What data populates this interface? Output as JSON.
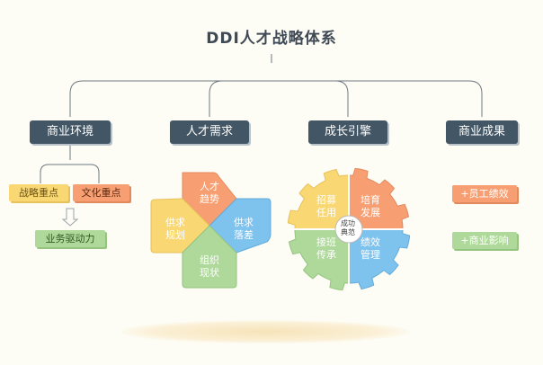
{
  "title": "DDI人才战略体系",
  "colors": {
    "header_bg": "#435665",
    "yellow": "#f9d772",
    "orange": "#f79f72",
    "green": "#aed99a",
    "blue": "#7ec2ee",
    "line": "#6d7780"
  },
  "columns": [
    {
      "header": "商业环境",
      "tags": [
        "战略重点",
        "文化重点"
      ],
      "result": "业务驱动力",
      "icon": "down-arrow-icon"
    },
    {
      "header": "人才需求",
      "quadrants": {
        "top": "人才\n趋势",
        "left": "供求\n规划",
        "right": "供求\n落差",
        "bottom": "组织\n现状"
      }
    },
    {
      "header": "成长引擎",
      "gear": {
        "top_left": "招募\n任用",
        "top_right": "培育\n发展",
        "bottom_left": "接班\n传承",
        "bottom_right": "绩效\n管理",
        "center": "成功\n典范"
      }
    },
    {
      "header": "商业成果",
      "tags": [
        "+员工绩效",
        "+商业影响"
      ]
    }
  ]
}
